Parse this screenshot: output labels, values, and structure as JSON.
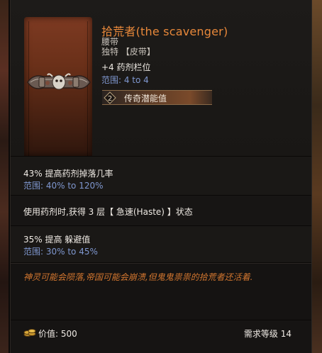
{
  "item": {
    "name": "拾荒者(the scavenger)",
    "type": "腰带",
    "rarity": "独特 【皮带】",
    "implicit": {
      "text": "+4 药剂栏位",
      "range": "范围: 4 to 4"
    },
    "legendary_potential": {
      "count": "2",
      "label": "传奇潜能值"
    }
  },
  "affixes": [
    {
      "text": "43% 提高药剂掉落几率",
      "range": "范围: 40% to 120%"
    },
    {
      "text": "使用药剂时,获得 3 层【 急速(Haste) 】状态",
      "range": ""
    },
    {
      "text": "35% 提高 躲避值",
      "range": "范围: 30% to 45%"
    }
  ],
  "lore": "神灵可能会陨落,帝国可能会崩溃,但鬼鬼祟祟的拾荒者还活着.",
  "footer": {
    "value": "价值: 500",
    "level": "需求等级  14"
  },
  "icons": {
    "coin": "coin-stack-icon",
    "legend": "legendary-potential-icon",
    "item": "belt-icon"
  },
  "colors": {
    "name": "#e8883a",
    "range": "#7f97cf",
    "lore": "#d2762f"
  }
}
